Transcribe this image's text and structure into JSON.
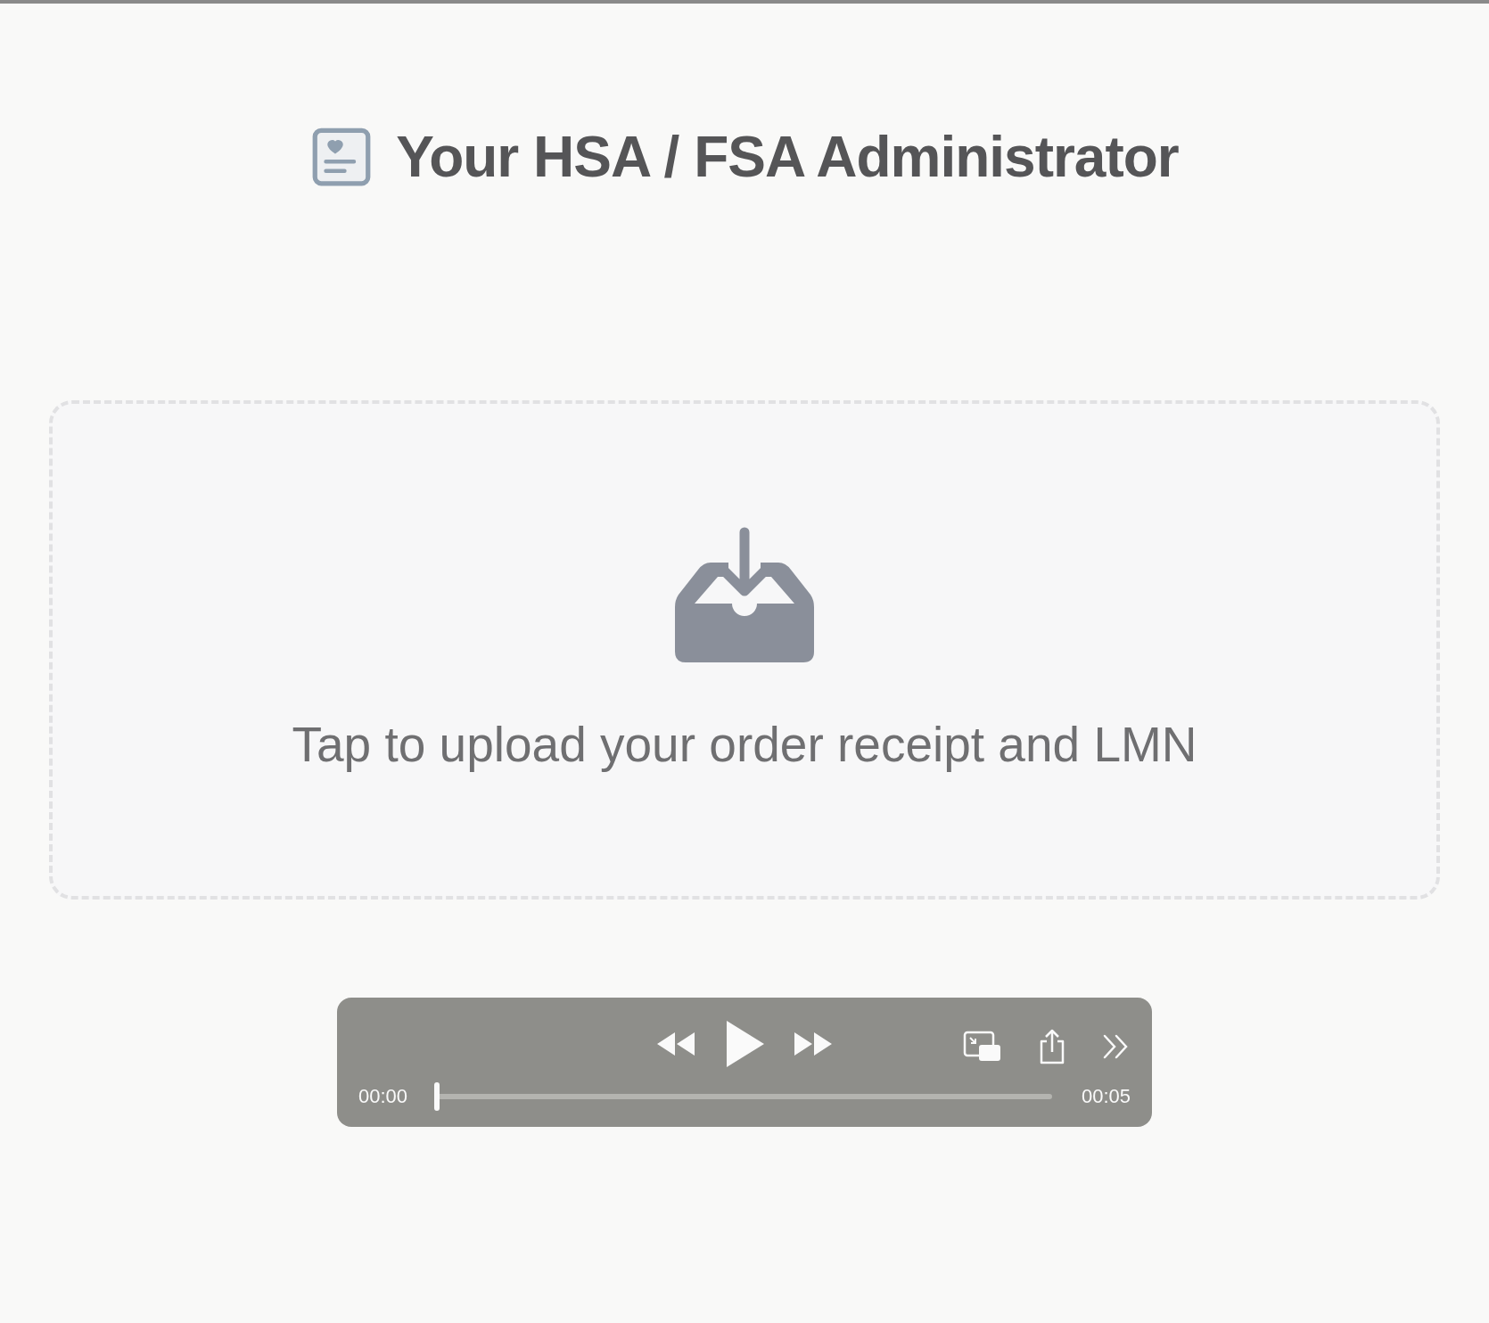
{
  "header": {
    "title": "Your HSA / FSA Administrator"
  },
  "upload": {
    "label": "Tap to upload your order receipt and LMN"
  },
  "player": {
    "elapsed": "00:00",
    "duration": "00:05",
    "level": 0
  }
}
